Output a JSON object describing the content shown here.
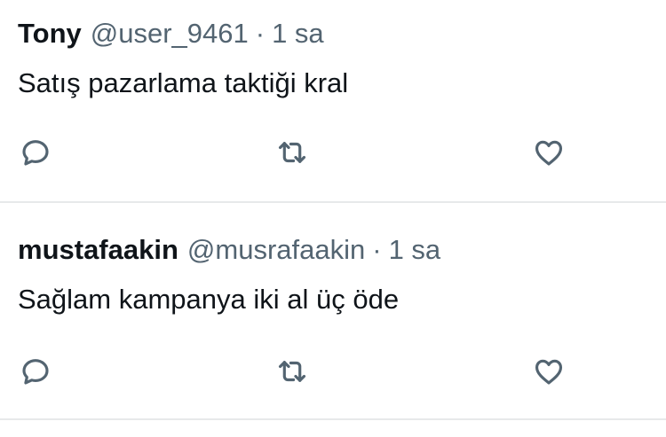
{
  "replies": [
    {
      "display_name": "Tony",
      "handle": "@user_9461",
      "separator": "·",
      "time": "1 sa",
      "text": "Satış pazarlama taktiği kral",
      "icons": [
        "reply-icon",
        "retweet-icon",
        "like-icon"
      ]
    },
    {
      "display_name": "mustafaakin",
      "handle": "@musrafaakin",
      "separator": "·",
      "time": "1 sa",
      "text": "Sağlam kampanya iki al üç öde",
      "icons": [
        "reply-icon",
        "retweet-icon",
        "like-icon"
      ]
    }
  ],
  "colors": {
    "text": "#0f1419",
    "secondary": "#536471",
    "divider": "#e7e9ea",
    "background": "#ffffff"
  }
}
